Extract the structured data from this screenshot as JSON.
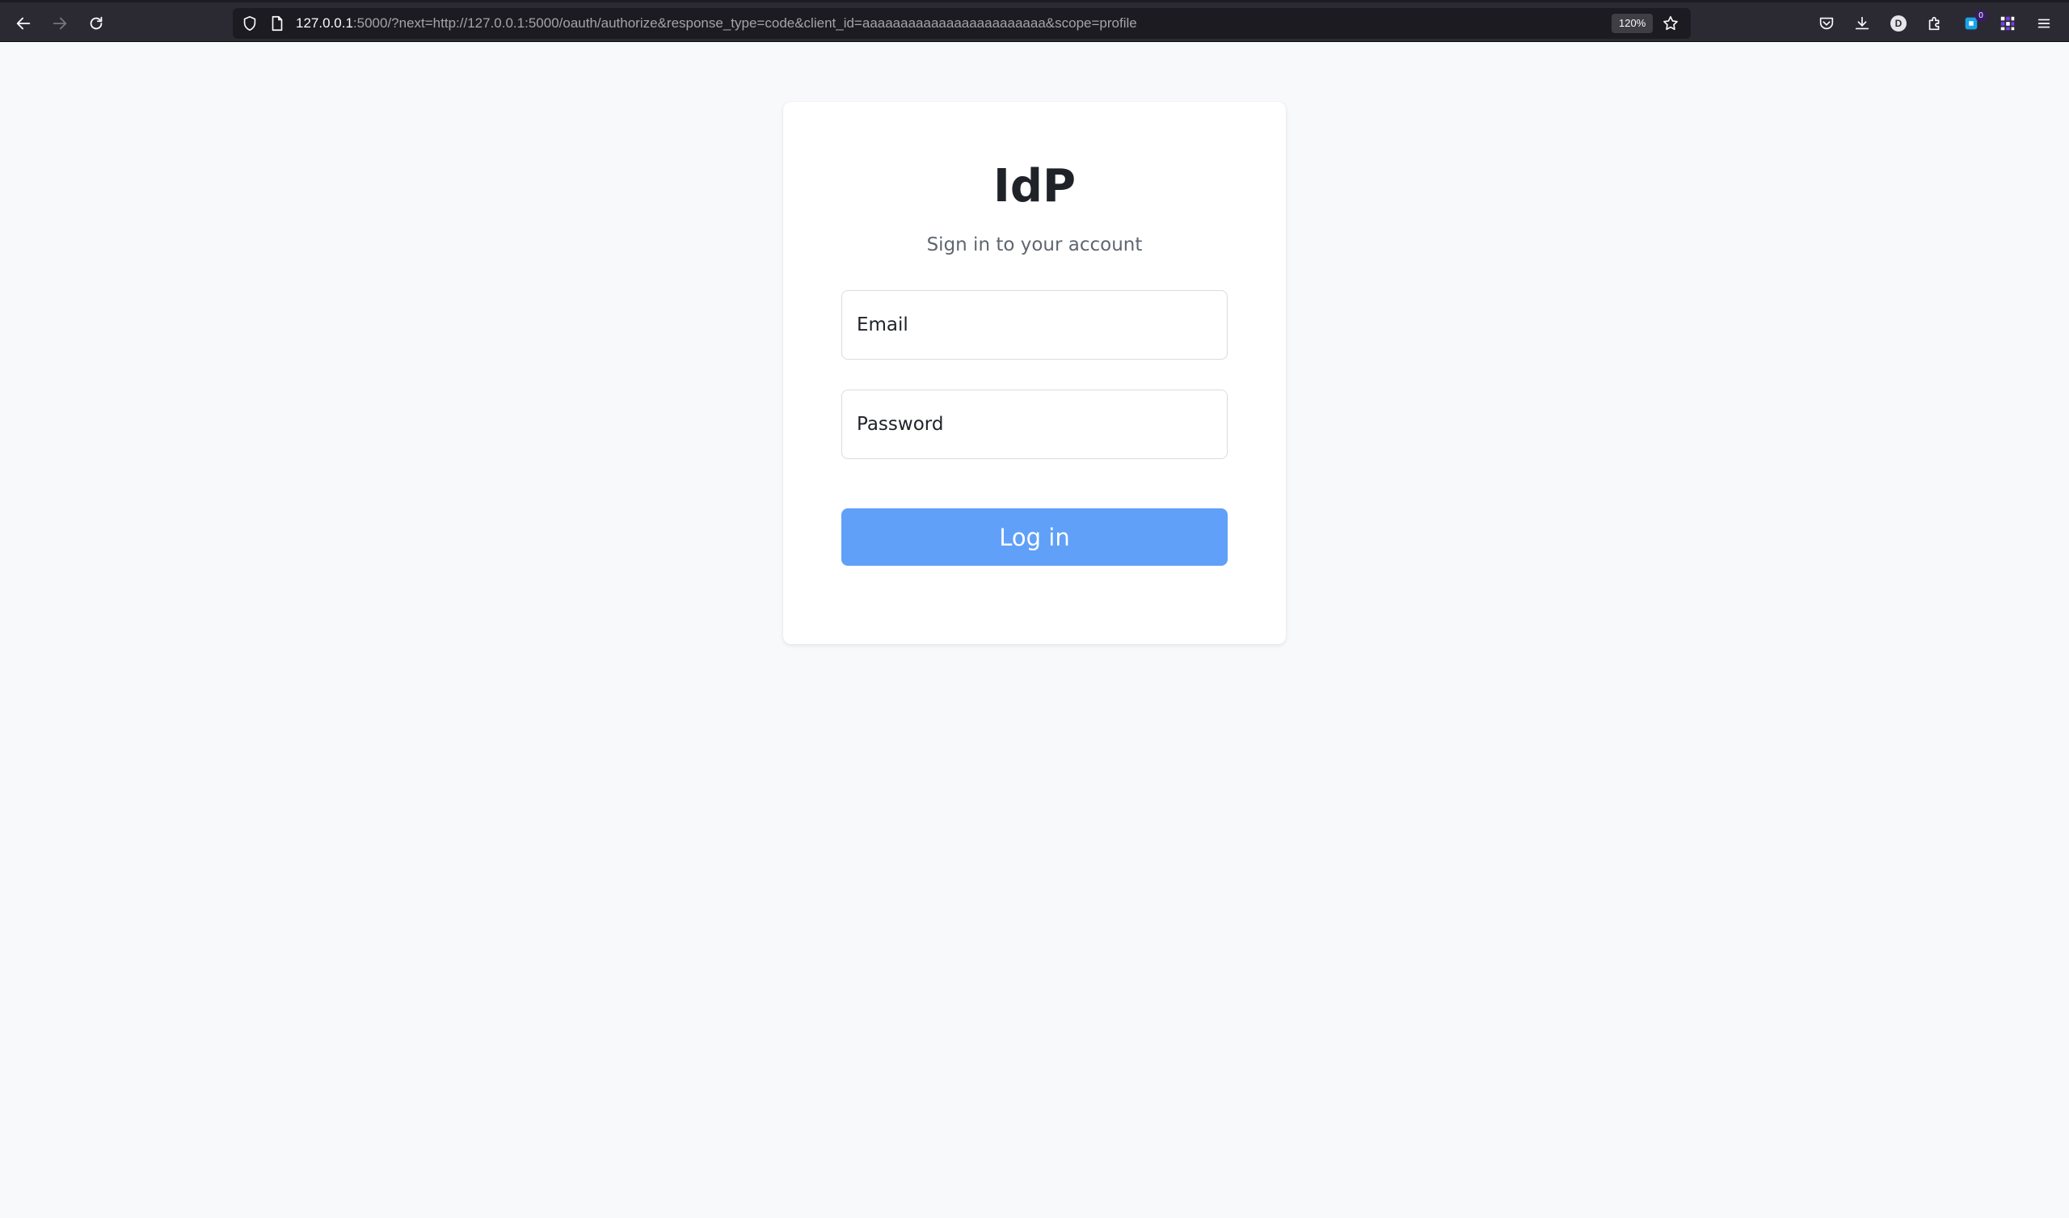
{
  "browser": {
    "url": {
      "host": "127.0.0.1",
      "rest": ":5000/?next=http://127.0.0.1:5000/oauth/authorize&response_type=code&client_id=aaaaaaaaaaaaaaaaaaaaaaaa&scope=profile"
    },
    "zoom": "120%",
    "account_initial": "D",
    "extension_badge": "0",
    "icons": {
      "back": "arrow-left-icon",
      "forward": "arrow-right-icon",
      "reload": "reload-icon",
      "tracking": "shield-icon",
      "page": "page-icon",
      "bookmark": "star-icon",
      "pocket": "pocket-icon",
      "downloads": "download-icon",
      "extensions": "puzzle-icon",
      "menu": "hamburger-menu-icon"
    }
  },
  "login": {
    "title": "IdP",
    "subtitle": "Sign in to your account",
    "email_placeholder": "Email",
    "password_placeholder": "Password",
    "submit_label": "Log in"
  },
  "colors": {
    "page_background": "#f8f9fb",
    "button": "#60a0f8",
    "title": "#1f2329",
    "subtitle": "#5f6670"
  }
}
